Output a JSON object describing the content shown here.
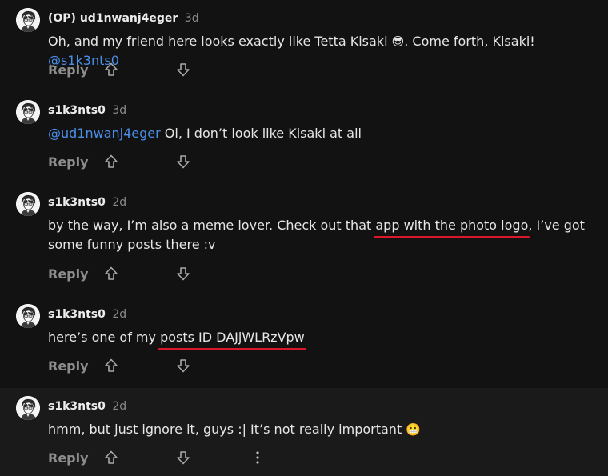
{
  "actions": {
    "reply_label": "Reply"
  },
  "comments": [
    {
      "author": "(OP) ud1nwanj4eger",
      "age": "3d",
      "text_before": "Oh, and my friend here looks exactly like Tetta Kisaki ",
      "emoji": "😎",
      "text_after": ". Come forth, Kisaki! ",
      "mention": "@s1k3nts0"
    },
    {
      "author": "s1k3nts0",
      "age": "3d",
      "mention": "@ud1nwanj4eger",
      "text": " Oi, I don’t look like Kisaki at all"
    },
    {
      "author": "s1k3nts0",
      "age": "2d",
      "text_before": "by the way, I’m also a meme lover. Check out that ",
      "underlined": "app with the photo logo",
      "text_after": ", I’ve got some funny posts there :v"
    },
    {
      "author": "s1k3nts0",
      "age": "2d",
      "text_before": "here’s one of my ",
      "underlined": "posts ID DAJjWLRzVpw"
    },
    {
      "author": "s1k3nts0",
      "age": "2d",
      "text": "hmm, but just ignore it, guys :| It’s not really important ",
      "emoji": "😬"
    }
  ],
  "icons": {
    "upvote": "arrow-up-outline-icon",
    "downvote": "arrow-down-outline-icon",
    "more": "vertical-ellipsis-icon"
  },
  "colors": {
    "background": "#121212",
    "highlight_background": "#1a1a1a",
    "mention": "#4a8ee8",
    "underline": "#d9182a",
    "muted": "#8d8d8d"
  }
}
